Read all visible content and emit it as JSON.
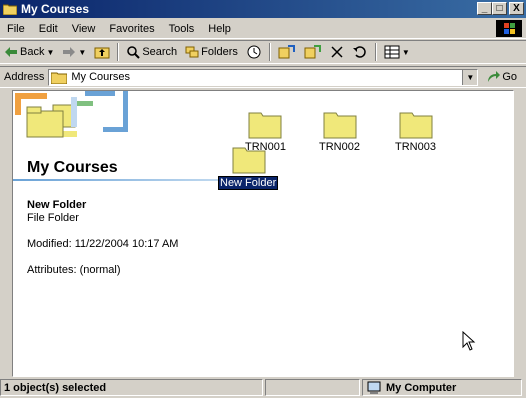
{
  "window": {
    "title": "My Courses",
    "buttons": {
      "minimize": "_",
      "maximize": "□",
      "close": "X"
    }
  },
  "menu": [
    "File",
    "Edit",
    "View",
    "Favorites",
    "Tools",
    "Help"
  ],
  "toolbar": {
    "back": "Back",
    "search": "Search",
    "folders": "Folders"
  },
  "address": {
    "label": "Address",
    "value": "My Courses",
    "go": "Go"
  },
  "pane": {
    "title": "My Courses",
    "selected": {
      "name": "New Folder",
      "type": "File Folder",
      "modified": "Modified: 11/22/2004 10:17 AM",
      "attributes": "Attributes: (normal)"
    }
  },
  "folders": [
    {
      "label": "TRN001"
    },
    {
      "label": "TRN002"
    },
    {
      "label": "TRN003"
    }
  ],
  "new_folder": {
    "label": "New Folder"
  },
  "status": {
    "selection": "1 object(s) selected",
    "zone": "My Computer"
  },
  "colors": {
    "title_bar": "#0a246a",
    "folder": "#f0e87a",
    "selection": "#0a246a"
  }
}
